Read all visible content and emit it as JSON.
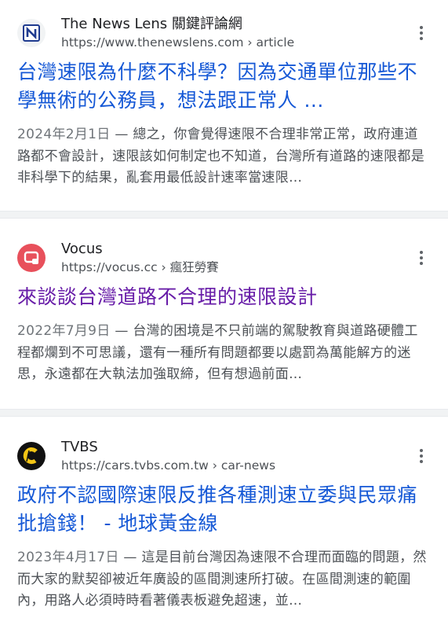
{
  "results": [
    {
      "site_name": "The News Lens 關鍵評論網",
      "url": "https://www.thenewslens.com",
      "breadcrumb": "› article",
      "favicon": "newslens-logo-icon",
      "title": "台灣速限為什麼不科學？因為交通單位那些不學無術的公務員，想法跟正常人 ...",
      "date": "2024年2月1日",
      "snippet": " — 總之，你會覺得速限不合理非常正常，政府連道路都不會設計，速限該如何制定也不知道，台灣所有道路的速限都是非科學下的結果，亂套用最低設計速率當速限…"
    },
    {
      "site_name": "Vocus",
      "url": "https://vocus.cc",
      "breadcrumb": "› 瘋狂勞賽",
      "favicon": "vocus-logo-icon",
      "title": "來談談台灣道路不合理的速限設計",
      "date": "2022年7月9日",
      "snippet": " — 台灣的困境是不只前端的駕駛教育與道路硬體工程都爛到不可思議，還有一種所有問題都要以處罰為萬能解方的迷思，永遠都在大執法加強取締，但有想過前面…"
    },
    {
      "site_name": "TVBS",
      "url": "https://cars.tvbs.com.tw",
      "breadcrumb": "› car-news",
      "favicon": "tvbs-car-logo-icon",
      "title": "政府不認國際速限反推各種測速立委與民眾痛批搶錢！ - 地球黃金線",
      "date": "2023年4月17日",
      "snippet": " — 這是目前台灣因為速限不合理而面臨的問題，然而大家的默契卻被近年廣設的區間測速所打破。在區間測速的範圍內，用路人必須時時看著儀表板避免超速，並…"
    }
  ],
  "colors": {
    "title_link": "#1558d6",
    "title_visited": "#681da8",
    "snippet": "#4d5156",
    "vocus_brand": "#e8505b",
    "tvbs_gold": "#f3c515",
    "newslens_blue": "#1f3b8f"
  }
}
